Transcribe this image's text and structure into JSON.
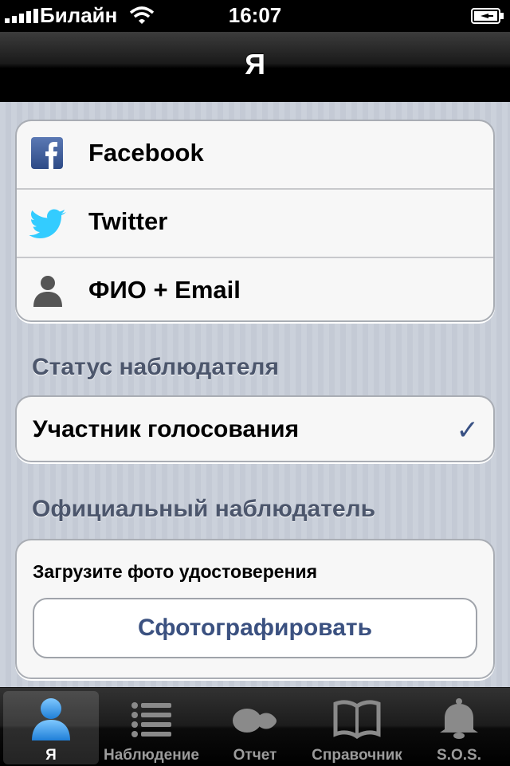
{
  "status_bar": {
    "carrier": "Билайн",
    "time": "16:07"
  },
  "nav": {
    "title": "Я"
  },
  "accounts": [
    {
      "label": "Facebook",
      "icon": "facebook-icon"
    },
    {
      "label": "Twitter",
      "icon": "twitter-bird-icon"
    },
    {
      "label": "ФИО + Email",
      "icon": "user-silhouette-icon"
    }
  ],
  "status_section": {
    "title": "Статус наблюдателя",
    "selected": "Участник голосования",
    "check_icon": "checkmark-icon"
  },
  "official_section": {
    "title": "Официальный наблюдатель",
    "prompt": "Загрузите фото удостоверения",
    "button": "Сфотографировать"
  },
  "tabs": [
    {
      "label": "Я",
      "icon": "person-icon",
      "active": true
    },
    {
      "label": "Наблюдение",
      "icon": "list-icon",
      "active": false
    },
    {
      "label": "Отчет",
      "icon": "report-icon",
      "active": false
    },
    {
      "label": "Справочник",
      "icon": "book-icon",
      "active": false
    },
    {
      "label": "S.O.S.",
      "icon": "bell-icon",
      "active": false
    }
  ],
  "colors": {
    "accent": "#3b5180",
    "section_text": "#4c566c",
    "active_tab_icon": "#3d9be9"
  }
}
